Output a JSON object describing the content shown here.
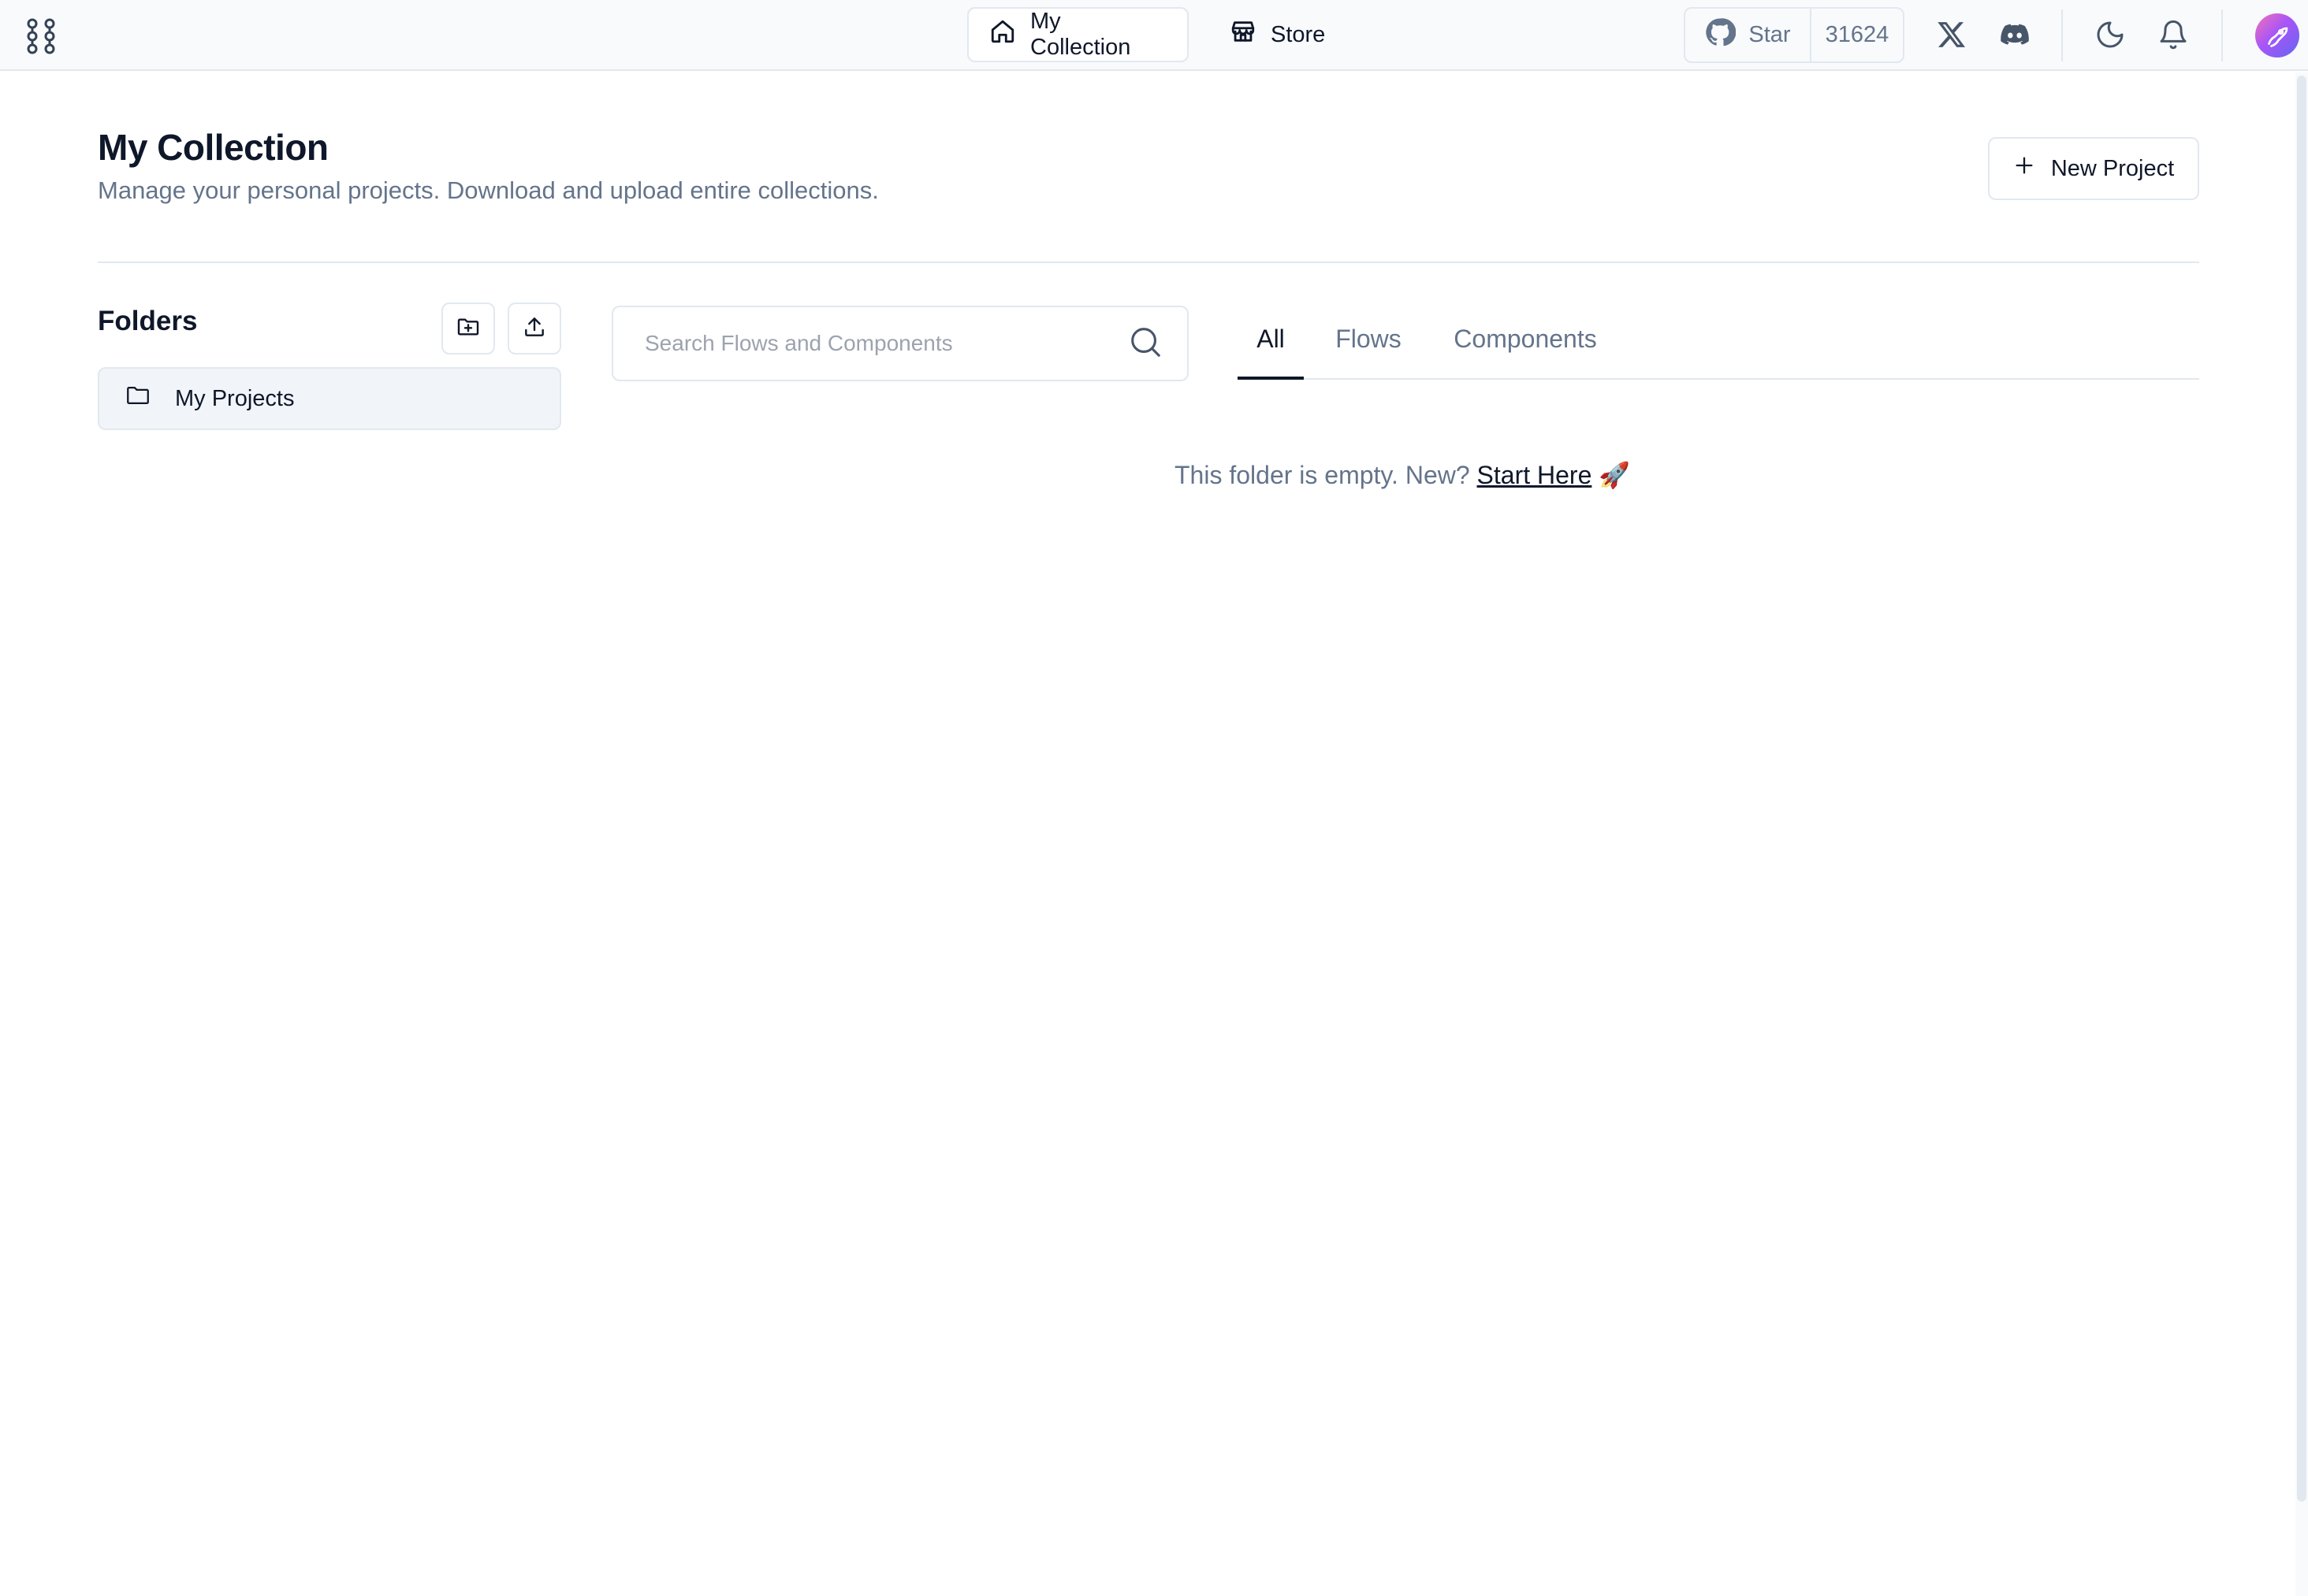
{
  "nav": {
    "my_collection": "My Collection",
    "store": "Store",
    "github_star": "Star",
    "github_count": "31624"
  },
  "header": {
    "title": "My Collection",
    "subtitle": "Manage your personal projects. Download and upload entire collections.",
    "new_project": "New Project"
  },
  "folders": {
    "title": "Folders",
    "items": [
      {
        "label": "My Projects"
      }
    ]
  },
  "search": {
    "placeholder": "Search Flows and Components"
  },
  "tabs": [
    "All",
    "Flows",
    "Components"
  ],
  "empty_state": {
    "text": "This folder is empty. New?",
    "link": "Start Here",
    "emoji": "🚀"
  },
  "colors": {
    "text_primary": "#0f172a",
    "text_muted": "#64748b",
    "border": "#e2e8f0",
    "topbar_bg": "#f8fafc"
  },
  "icons": [
    "langflow-logo-icon",
    "home-icon",
    "store-icon",
    "github-icon",
    "x-twitter-icon",
    "discord-icon",
    "moon-icon",
    "bell-icon",
    "user-avatar",
    "plus-icon",
    "folder-plus-icon",
    "upload-icon",
    "folder-icon",
    "search-icon"
  ]
}
